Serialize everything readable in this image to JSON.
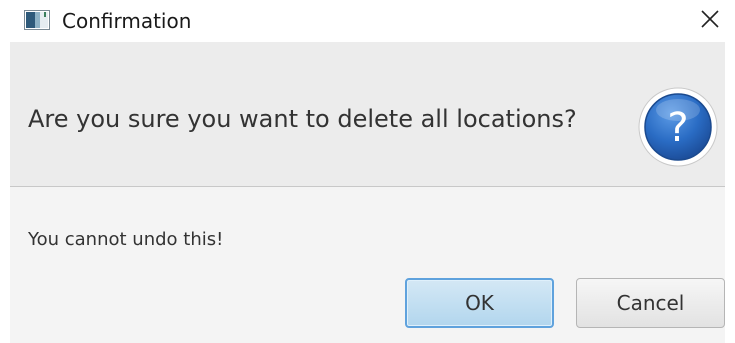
{
  "window": {
    "title": "Confirmation",
    "icon": "java-window-icon",
    "close_icon": "close-x-icon"
  },
  "dialog": {
    "header_text": "Are you sure you want to delete all locations?",
    "header_icon": "question-icon",
    "header_icon_glyph": "?",
    "content_text": "You cannot undo this!",
    "buttons": {
      "ok_label": "OK",
      "cancel_label": "Cancel"
    }
  },
  "colors": {
    "accent": "#2f6fc8",
    "ok_border": "#5fa2dd",
    "header_bg": "#ececec",
    "content_bg": "#f4f4f4"
  }
}
